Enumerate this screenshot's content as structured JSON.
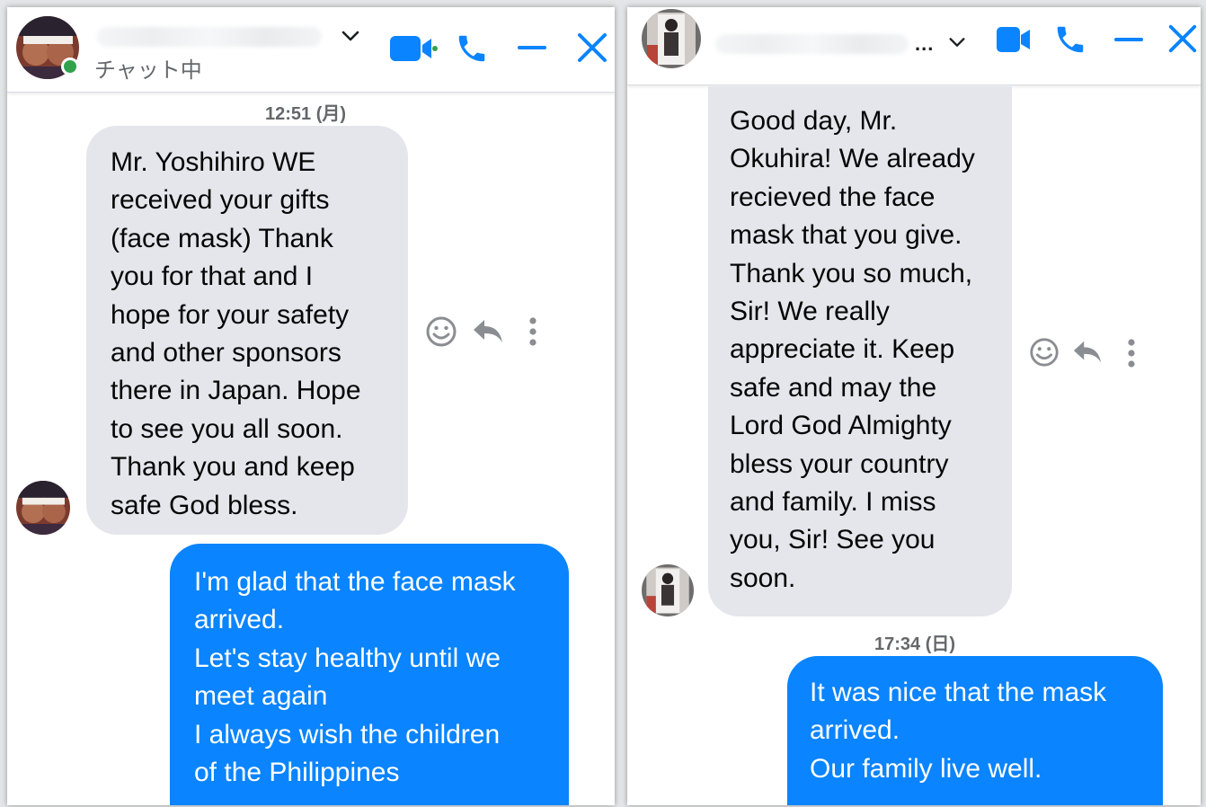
{
  "left_chat": {
    "status": "チャット中",
    "timestamp": "12:51 (月)",
    "incoming_message": "Mr. Yoshihiro WE\nreceived your gifts\n(face mask) Thank\nyou for that and I\nhope for your safety\nand other sponsors\nthere in Japan. Hope\nto see you all soon.\nThank you and keep\nsafe God bless.",
    "outgoing_message": "I'm glad that the face mask\narrived.\nLet's stay healthy until we\nmeet again\nI always wish the children\nof the Philippines"
  },
  "right_chat": {
    "name_ellipsis": "...",
    "timestamp": "17:34 (日)",
    "incoming_message": "Good day, Mr.\nOkuhira! We already\nrecieved the face\nmask that you give.\nThank you so much,\nSir! We really\nappreciate it. Keep\nsafe and may the\nLord God Almighty\nbless your country\nand family. I miss\nyou, Sir! See you\nsoon.",
    "outgoing_message": "It was nice that the mask\narrived.\nOur family live well."
  },
  "colors": {
    "accent": "#0a84ff",
    "incoming_bubble": "#e4e6eb",
    "online": "#31a24c",
    "icon_gray": "#8a8d91"
  },
  "icons": [
    "chevron-down-icon",
    "video-call-icon",
    "phone-icon",
    "minimize-icon",
    "close-icon",
    "emoji-icon",
    "reply-icon",
    "more-icon"
  ]
}
